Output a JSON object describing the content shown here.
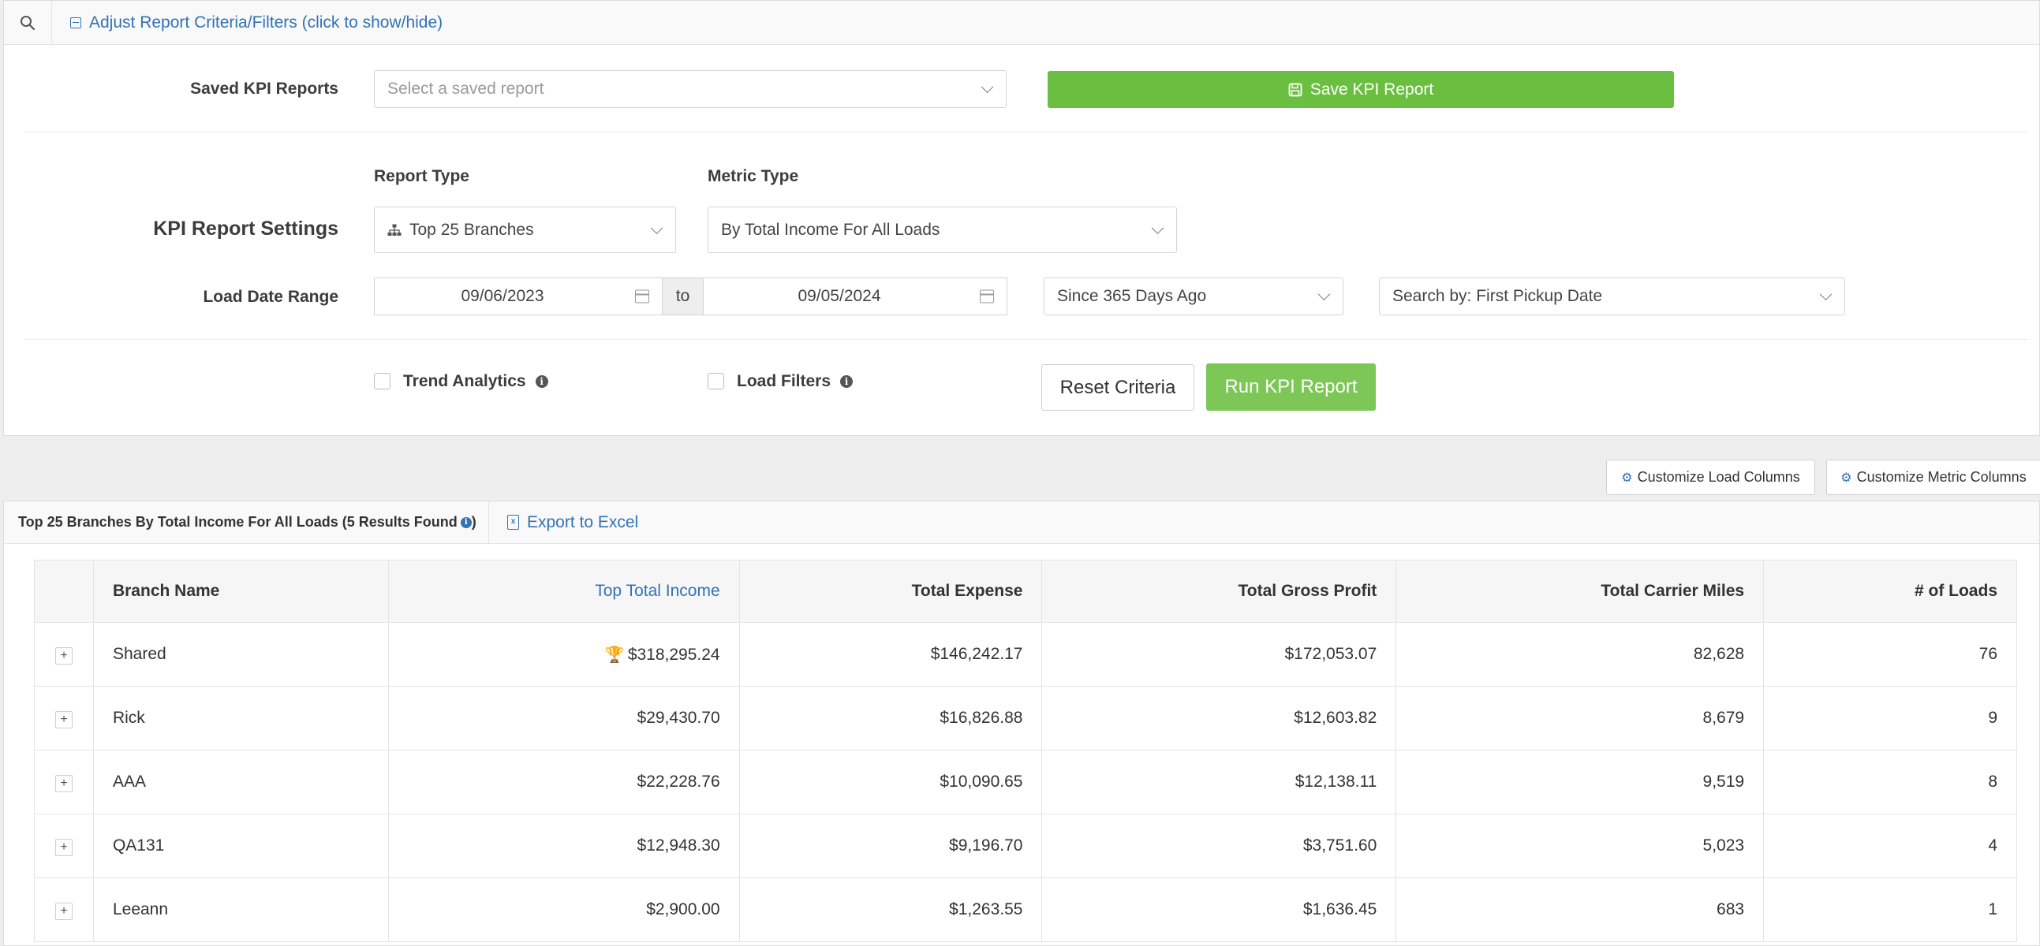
{
  "criteria": {
    "toggle_label": "Adjust Report Criteria/Filters (click to show/hide)",
    "saved_reports": {
      "label": "Saved KPI Reports",
      "placeholder": "Select a saved report",
      "save_button": "Save KPI Report"
    },
    "settings": {
      "label": "KPI Report Settings",
      "report_type_label": "Report Type",
      "report_type_value": "Top 25 Branches",
      "metric_type_label": "Metric Type",
      "metric_type_value": "By Total Income For All Loads"
    },
    "date_range": {
      "label": "Load Date Range",
      "from": "09/06/2023",
      "to_label": "to",
      "to": "09/05/2024",
      "preset": "Since 365 Days Ago",
      "search_by": "Search by: First Pickup Date"
    },
    "options": {
      "trend_analytics": "Trend Analytics",
      "load_filters": "Load Filters"
    },
    "buttons": {
      "reset": "Reset Criteria",
      "run": "Run KPI Report"
    }
  },
  "customize": {
    "load_columns": "Customize Load Columns",
    "metric_columns": "Customize Metric Columns"
  },
  "results": {
    "title": "Top 25 Branches By Total Income For All Loads (5 Results Found",
    "title_suffix": ")",
    "export": "Export to Excel",
    "columns": {
      "branch": "Branch Name",
      "income": "Top Total Income",
      "expense": "Total Expense",
      "profit": "Total Gross Profit",
      "miles": "Total Carrier Miles",
      "loads": "# of Loads"
    },
    "rows": [
      {
        "branch": "Shared",
        "income": "$318,295.24",
        "expense": "$146,242.17",
        "profit": "$172,053.07",
        "miles": "82,628",
        "loads": "76"
      },
      {
        "branch": "Rick",
        "income": "$29,430.70",
        "expense": "$16,826.88",
        "profit": "$12,603.82",
        "miles": "8,679",
        "loads": "9"
      },
      {
        "branch": "AAA",
        "income": "$22,228.76",
        "expense": "$10,090.65",
        "profit": "$12,138.11",
        "miles": "9,519",
        "loads": "8"
      },
      {
        "branch": "QA131",
        "income": "$12,948.30",
        "expense": "$9,196.70",
        "profit": "$3,751.60",
        "miles": "5,023",
        "loads": "4"
      },
      {
        "branch": "Leeann",
        "income": "$2,900.00",
        "expense": "$1,263.55",
        "profit": "$1,636.45",
        "miles": "683",
        "loads": "1"
      }
    ]
  },
  "icons": {
    "search": "search-icon",
    "collapse": "minus-square-icon",
    "save": "floppy-disk-icon",
    "branches": "sitemap-icon",
    "calendar": "calendar-icon",
    "info": "info-circle-icon",
    "gears": "gears-icon",
    "excel": "file-excel-icon",
    "trophy": "trophy-icon",
    "expand": "plus-icon"
  },
  "colors": {
    "primary_green": "#6abf40",
    "link_blue": "#3272b6"
  }
}
